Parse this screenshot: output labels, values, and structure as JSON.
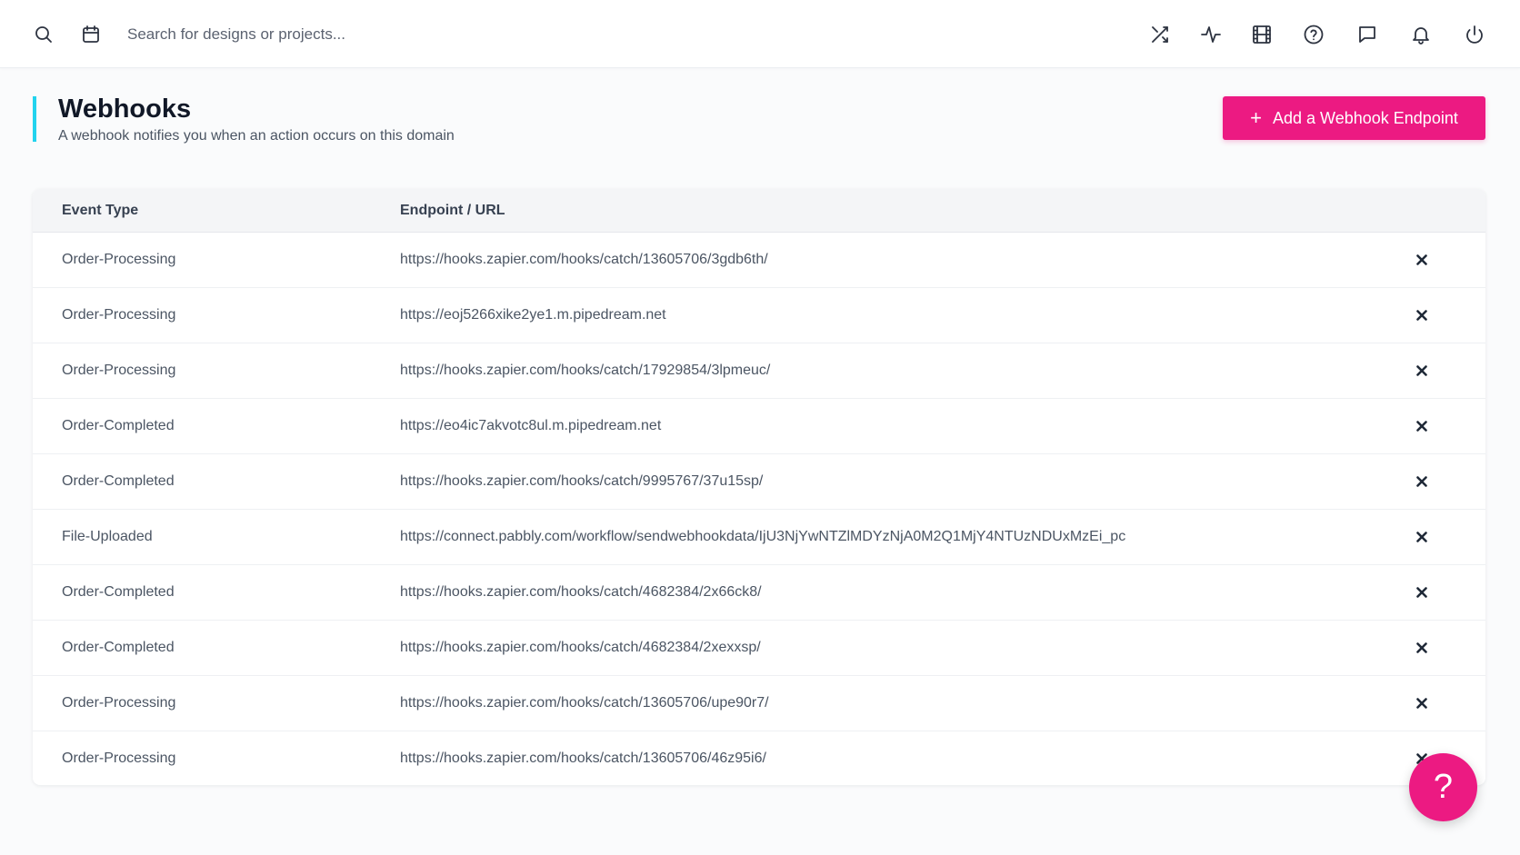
{
  "topbar": {
    "search_placeholder": "Search for designs or projects...",
    "icons": [
      "search-icon",
      "calendar-icon",
      "shuffle-icon",
      "activity-icon",
      "film-icon",
      "help-circle-icon",
      "message-icon",
      "bell-icon",
      "power-icon"
    ]
  },
  "header": {
    "title": "Webhooks",
    "subtitle": "A webhook notifies you when an action occurs on this domain",
    "accent_color": "#22d3ee"
  },
  "add_button": {
    "plus": "+",
    "label": "Add a Webhook Endpoint",
    "color": "#ec1a82"
  },
  "table": {
    "columns": [
      "Event Type",
      "Endpoint / URL"
    ],
    "rows": [
      {
        "event": "Order-Processing",
        "url": "https://hooks.zapier.com/hooks/catch/13605706/3gdb6th/"
      },
      {
        "event": "Order-Processing",
        "url": "https://eoj5266xike2ye1.m.pipedream.net"
      },
      {
        "event": "Order-Processing",
        "url": "https://hooks.zapier.com/hooks/catch/17929854/3lpmeuc/"
      },
      {
        "event": "Order-Completed",
        "url": "https://eo4ic7akvotc8ul.m.pipedream.net"
      },
      {
        "event": "Order-Completed",
        "url": "https://hooks.zapier.com/hooks/catch/9995767/37u15sp/"
      },
      {
        "event": "File-Uploaded",
        "url": "https://connect.pabbly.com/workflow/sendwebhookdata/IjU3NjYwNTZlMDYzNjA0M2Q1MjY4NTUzNDUxMzEi_pc"
      },
      {
        "event": "Order-Completed",
        "url": "https://hooks.zapier.com/hooks/catch/4682384/2x66ck8/"
      },
      {
        "event": "Order-Completed",
        "url": "https://hooks.zapier.com/hooks/catch/4682384/2xexxsp/"
      },
      {
        "event": "Order-Processing",
        "url": "https://hooks.zapier.com/hooks/catch/13605706/upe90r7/"
      },
      {
        "event": "Order-Processing",
        "url": "https://hooks.zapier.com/hooks/catch/13605706/46z95i6/"
      }
    ]
  },
  "help_fab": {
    "label": "?",
    "color": "#ec1a82"
  }
}
